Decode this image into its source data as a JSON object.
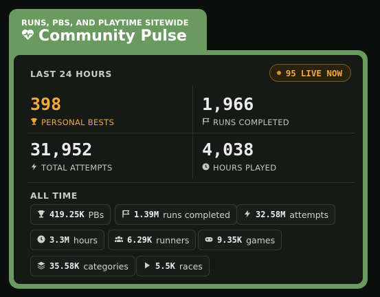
{
  "header": {
    "kicker": "RUNS, PBS, AND PLAYTIME SITEWIDE",
    "title": "Community Pulse",
    "icon": "heart-pulse-icon"
  },
  "last24": {
    "label": "LAST 24 HOURS",
    "live_count": "95",
    "live_label": "LIVE NOW",
    "stats": [
      {
        "value": "398",
        "label": "PERSONAL BESTS",
        "icon": "trophy-icon"
      },
      {
        "value": "1,966",
        "label": "RUNS COMPLETED",
        "icon": "flag-icon"
      },
      {
        "value": "31,952",
        "label": "TOTAL ATTEMPTS",
        "icon": "bolt-icon"
      },
      {
        "value": "4,038",
        "label": "HOURS PLAYED",
        "icon": "clock-icon"
      }
    ]
  },
  "alltime": {
    "label": "ALL TIME",
    "pills": [
      {
        "value": "419.25K",
        "label": "PBs",
        "icon": "trophy-icon"
      },
      {
        "value": "1.39M",
        "label": "runs completed",
        "icon": "flag-icon"
      },
      {
        "value": "32.58M",
        "label": "attempts",
        "icon": "bolt-icon"
      },
      {
        "value": "3.3M",
        "label": "hours",
        "icon": "clock-icon"
      },
      {
        "value": "6.29K",
        "label": "runners",
        "icon": "users-icon"
      },
      {
        "value": "9.35K",
        "label": "games",
        "icon": "gamepad-icon"
      },
      {
        "value": "35.58K",
        "label": "categories",
        "icon": "layers-icon"
      },
      {
        "value": "5.5K",
        "label": "races",
        "icon": "play-icon"
      }
    ]
  },
  "colors": {
    "accent": "#6a9a60",
    "highlight": "#f2a93b",
    "panel": "#161a17"
  }
}
